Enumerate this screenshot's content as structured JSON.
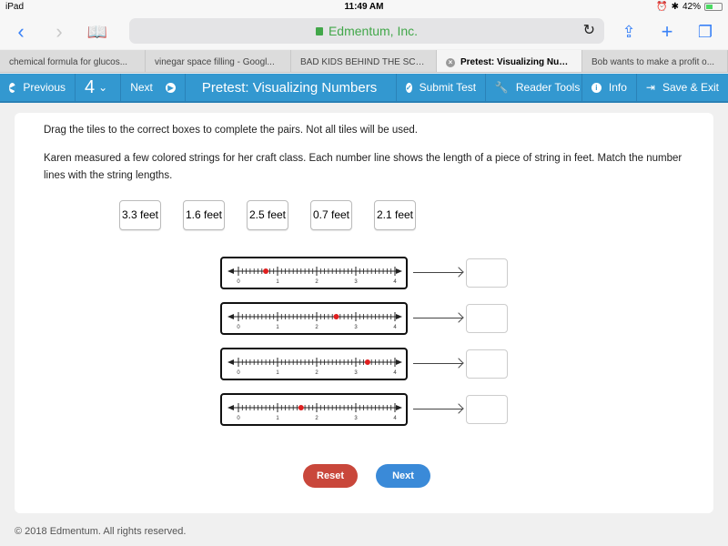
{
  "status_bar": {
    "device": "iPad",
    "time": "11:49 AM",
    "battery": "42%",
    "battery_fraction": 0.42
  },
  "browser": {
    "url_text": "Edmentum, Inc.",
    "tabs": [
      {
        "label": "chemical formula for glucos...",
        "active": false
      },
      {
        "label": "vinegar space filling - Googl...",
        "active": false
      },
      {
        "label": "BAD KIDS BEHIND THE SCE...",
        "active": false
      },
      {
        "label": "Pretest: Visualizing Numb...",
        "active": true
      },
      {
        "label": "Bob wants to make a profit o...",
        "active": false
      }
    ]
  },
  "toolbar": {
    "previous": "Previous",
    "question_number": "4",
    "next": "Next",
    "title": "Pretest: Visualizing Numbers",
    "submit": "Submit Test",
    "reader_tools": "Reader Tools",
    "info": "Info",
    "save_exit": "Save & Exit"
  },
  "question": {
    "instruction": "Drag the tiles to the correct boxes to complete the pairs. Not all tiles will be used.",
    "prompt": "Karen measured a few colored strings for her craft class. Each number line shows the length of a piece of string in feet. Match the number lines with the string lengths.",
    "tiles": [
      "3.3 feet",
      "1.6 feet",
      "2.5 feet",
      "0.7 feet",
      "2.1 feet"
    ],
    "number_lines": [
      {
        "point": 0.7
      },
      {
        "point": 2.5
      },
      {
        "point": 3.3
      },
      {
        "point": 1.6
      }
    ],
    "axis": {
      "min": 0,
      "max": 4,
      "tick_step": 0.1,
      "labels": [
        "0",
        "1",
        "2",
        "3",
        "4"
      ]
    },
    "point_color": "#e02020"
  },
  "buttons": {
    "reset": "Reset",
    "next": "Next"
  },
  "footer": {
    "copyright": "© 2018 Edmentum. All rights reserved."
  }
}
